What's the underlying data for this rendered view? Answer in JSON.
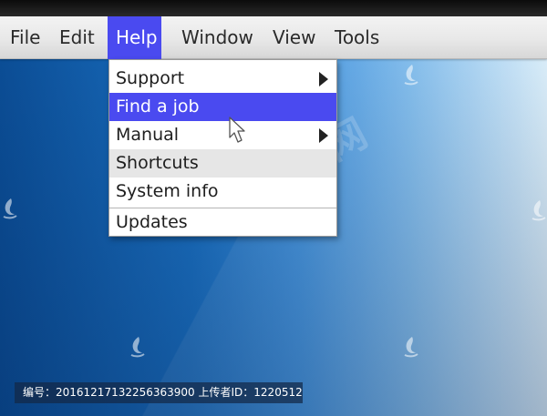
{
  "menubar": {
    "items": [
      {
        "label": "File",
        "active": false
      },
      {
        "label": "Edit",
        "active": false
      },
      {
        "label": "Help",
        "active": true
      },
      {
        "label": "Window",
        "active": false
      },
      {
        "label": "View",
        "active": false
      },
      {
        "label": "Tools",
        "active": false
      }
    ]
  },
  "dropdown": {
    "items": [
      {
        "label": "Support",
        "has_submenu": true,
        "state": "normal"
      },
      {
        "label": "Find a job",
        "has_submenu": false,
        "state": "highlighted"
      },
      {
        "label": "Manual",
        "has_submenu": true,
        "state": "normal"
      },
      {
        "label": "Shortcuts",
        "has_submenu": false,
        "state": "hover"
      },
      {
        "label": "System info",
        "has_submenu": false,
        "state": "normal"
      },
      {
        "label": "Updates",
        "has_submenu": false,
        "state": "normal"
      }
    ]
  },
  "watermark": {
    "text": "汇图网",
    "info": "编号：20161217132256363900 上传者ID：1220512"
  },
  "icons": {
    "submenu_arrow": "triangle-right-icon",
    "cursor": "mouse-pointer-icon",
    "watermark": "watermark-logo-icon"
  },
  "colors": {
    "highlight": "#4a4af0",
    "hover": "#e6e6e6",
    "menubar": "#e8e8e8",
    "desktop_dark": "#0b4d95",
    "desktop_light": "#d6ebf8"
  }
}
